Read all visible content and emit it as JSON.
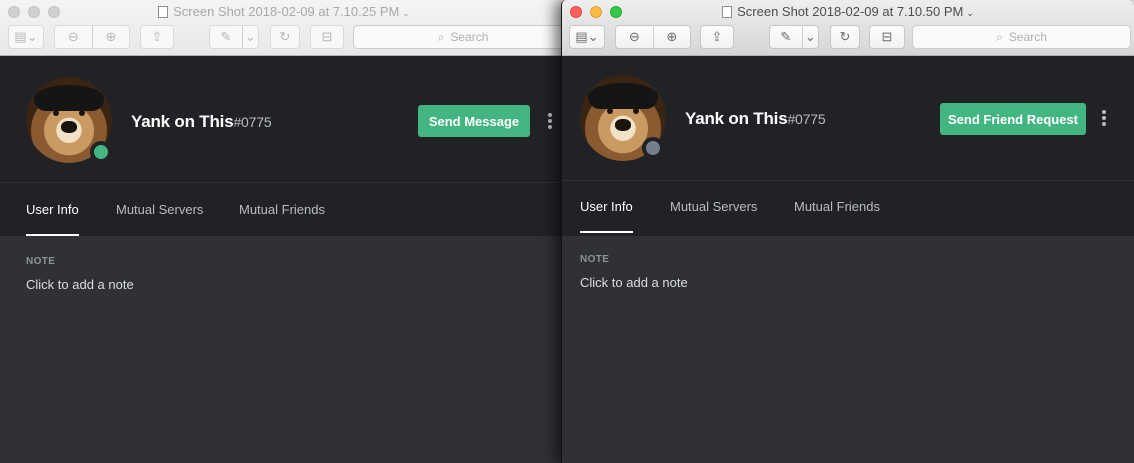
{
  "windows": [
    {
      "title": "Screen Shot 2018-02-09 at 7.10.25 PM",
      "search_placeholder": "Search",
      "profile": {
        "username": "Yank on This",
        "discriminator": "#0775",
        "status": "online",
        "status_color": "#43b581",
        "primary_action": "Send Message",
        "tabs": [
          "User Info",
          "Mutual Servers",
          "Mutual Friends"
        ],
        "active_tab": "User Info",
        "note_label": "NOTE",
        "note_placeholder": "Click to add a note"
      }
    },
    {
      "title": "Screen Shot 2018-02-09 at 7.10.50 PM",
      "search_placeholder": "Search",
      "profile": {
        "username": "Yank on This",
        "discriminator": "#0775",
        "status": "offline",
        "status_color": "#747f8d",
        "primary_action": "Send Friend Request",
        "tabs": [
          "User Info",
          "Mutual Servers",
          "Mutual Friends"
        ],
        "active_tab": "User Info",
        "note_label": "NOTE",
        "note_placeholder": "Click to add a note"
      }
    }
  ],
  "icons": {
    "document": "document-icon",
    "sidebar": "sidebar-icon",
    "zoom_out": "zoom-out-icon",
    "zoom_in": "zoom-in-icon",
    "share": "share-icon",
    "markup": "pen-icon",
    "rotate": "rotate-icon",
    "toolbox": "toolbox-icon",
    "search": "search-icon",
    "more": "more-vertical-icon"
  }
}
